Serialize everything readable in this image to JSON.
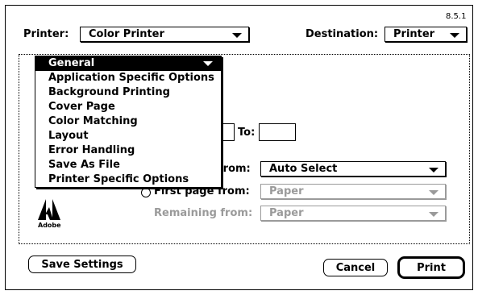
{
  "dialog": {
    "version": "8.5.1",
    "printer_label": "Printer:",
    "printer_value": "Color Printer",
    "destination_label": "Destination:",
    "destination_value": "Printer"
  },
  "menu": {
    "items": [
      {
        "label": "General"
      },
      {
        "label": "Application Specific Options"
      },
      {
        "label": "Background Printing"
      },
      {
        "label": "Cover Page"
      },
      {
        "label": "Color Matching"
      },
      {
        "label": "Layout"
      },
      {
        "label": "Error Handling"
      },
      {
        "label": "Save As File"
      },
      {
        "label": "Printer Specific Options"
      }
    ]
  },
  "form": {
    "to_label": "To:",
    "from_label": "from:",
    "paper_source_value": "Auto Select",
    "first_page_label": "First page from:",
    "first_page_value": "Paper",
    "remaining_label": "Remaining from:",
    "remaining_value": "Paper"
  },
  "logo": {
    "text": "Adobe"
  },
  "buttons": {
    "save_settings": "Save Settings",
    "cancel": "Cancel",
    "print": "Print"
  },
  "colors": {
    "disabled": "#9a9a9a",
    "selection": "#000000"
  }
}
